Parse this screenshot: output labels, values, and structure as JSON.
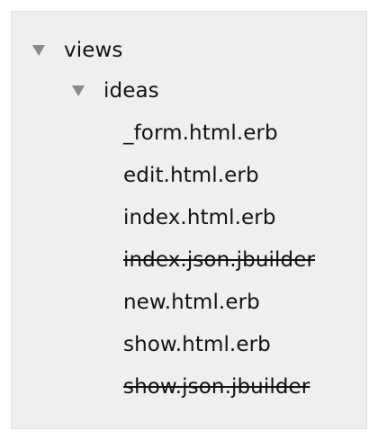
{
  "tree": {
    "root": {
      "name": "views",
      "icon": "triangle-down-icon",
      "expanded": true
    },
    "child": {
      "name": "ideas",
      "icon": "triangle-down-icon",
      "expanded": true
    },
    "files": [
      {
        "name": "_form.html.erb",
        "strikethrough": false
      },
      {
        "name": "edit.html.erb",
        "strikethrough": false
      },
      {
        "name": "index.html.erb",
        "strikethrough": false
      },
      {
        "name": "index.json.jbuilder",
        "strikethrough": true
      },
      {
        "name": "new.html.erb",
        "strikethrough": false
      },
      {
        "name": "show.html.erb",
        "strikethrough": false
      },
      {
        "name": "show.json.jbuilder",
        "strikethrough": true
      }
    ],
    "colors": {
      "panel_background": "#efefef",
      "text": "#121212",
      "disclosure_triangle": "#8a8a8a"
    }
  }
}
